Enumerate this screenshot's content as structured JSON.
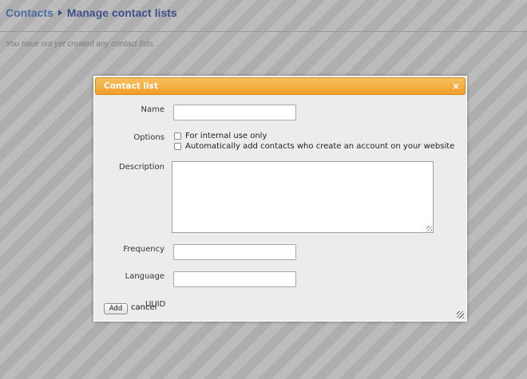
{
  "header": {
    "breadcrumb_root": "Contacts",
    "title": "Manage contact lists"
  },
  "empty_message": "You have not yet created any contact lists.",
  "dialog": {
    "title": "Contact list",
    "close_glyph": "×",
    "name_label": "Name",
    "name_value": "",
    "options_label": "Options",
    "option_internal": "For internal use only",
    "option_internal_checked": false,
    "option_auto_add": "Automatically add contacts who create an account on your website",
    "option_auto_add_checked": false,
    "description_label": "Description",
    "description_value": "",
    "frequency_label": "Frequency",
    "frequency_value": "",
    "language_label": "Language",
    "language_value": "",
    "uuid_label": "UUID",
    "add_label": "Add",
    "cancel_label": "cancel"
  },
  "colors": {
    "titlebar": "#f0a32e",
    "breadcrumb": "#3f4f8a",
    "dialog_bg": "#ececec"
  }
}
